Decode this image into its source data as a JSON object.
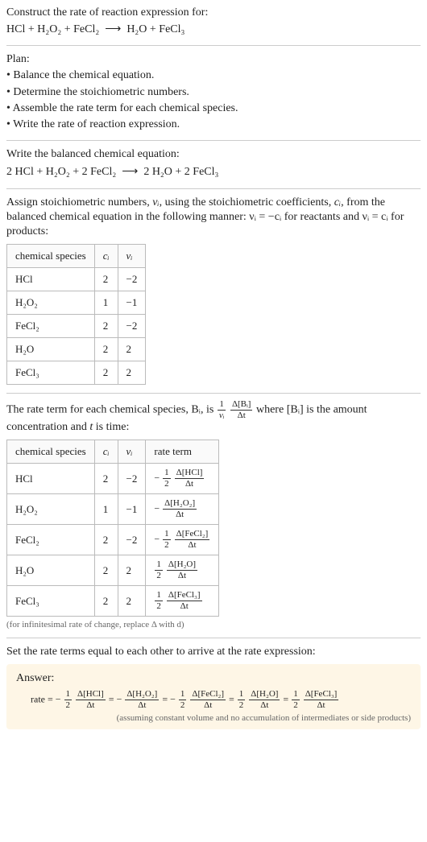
{
  "header": {
    "title": "Construct the rate of reaction expression for:",
    "equation_lhs": "HCl + H₂O₂ + FeCl₂",
    "arrow": "⟶",
    "equation_rhs": "H₂O + FeCl₃"
  },
  "plan": {
    "label": "Plan:",
    "items": [
      "• Balance the chemical equation.",
      "• Determine the stoichiometric numbers.",
      "• Assemble the rate term for each chemical species.",
      "• Write the rate of reaction expression."
    ]
  },
  "balanced": {
    "label": "Write the balanced chemical equation:",
    "equation_lhs": "2 HCl + H₂O₂ + 2 FeCl₂",
    "arrow": "⟶",
    "equation_rhs": "2 H₂O + 2 FeCl₃"
  },
  "stoich_intro": {
    "pre": "Assign stoichiometric numbers, ",
    "nu_i": "νᵢ",
    "mid1": ", using the stoichiometric coefficients, ",
    "c_i": "cᵢ",
    "mid2": ", from the balanced chemical equation in the following manner: ",
    "rule1": "νᵢ = −cᵢ",
    "mid3": " for reactants and ",
    "rule2": "νᵢ = cᵢ",
    "mid4": " for products:"
  },
  "table1": {
    "headers": {
      "species": "chemical species",
      "c": "cᵢ",
      "nu": "νᵢ"
    },
    "rows": [
      {
        "species": "HCl",
        "c": "2",
        "nu": "−2"
      },
      {
        "species": "H₂O₂",
        "c": "1",
        "nu": "−1"
      },
      {
        "species": "FeCl₂",
        "c": "2",
        "nu": "−2"
      },
      {
        "species": "H₂O",
        "c": "2",
        "nu": "2"
      },
      {
        "species": "FeCl₃",
        "c": "2",
        "nu": "2"
      }
    ]
  },
  "rateterm_intro": {
    "pre": "The rate term for each chemical species, ",
    "B_i": "Bᵢ",
    "mid1": ", is ",
    "frac1_num": "1",
    "frac1_den": "νᵢ",
    "frac2_num": "Δ[Bᵢ]",
    "frac2_den": "Δt",
    "mid2": " where ",
    "conc": "[Bᵢ]",
    "mid3": " is the amount concentration and ",
    "t": "t",
    "mid4": " is time:"
  },
  "table2": {
    "headers": {
      "species": "chemical species",
      "c": "cᵢ",
      "nu": "νᵢ",
      "rate": "rate term"
    },
    "rows": [
      {
        "species": "HCl",
        "c": "2",
        "nu": "−2",
        "sign": "−",
        "coef_num": "1",
        "coef_den": "2",
        "d_num": "Δ[HCl]",
        "d_den": "Δt"
      },
      {
        "species": "H₂O₂",
        "c": "1",
        "nu": "−1",
        "sign": "−",
        "coef_num": "",
        "coef_den": "",
        "d_num": "Δ[H₂O₂]",
        "d_den": "Δt"
      },
      {
        "species": "FeCl₂",
        "c": "2",
        "nu": "−2",
        "sign": "−",
        "coef_num": "1",
        "coef_den": "2",
        "d_num": "Δ[FeCl₂]",
        "d_den": "Δt"
      },
      {
        "species": "H₂O",
        "c": "2",
        "nu": "2",
        "sign": "",
        "coef_num": "1",
        "coef_den": "2",
        "d_num": "Δ[H₂O]",
        "d_den": "Δt"
      },
      {
        "species": "FeCl₃",
        "c": "2",
        "nu": "2",
        "sign": "",
        "coef_num": "1",
        "coef_den": "2",
        "d_num": "Δ[FeCl₃]",
        "d_den": "Δt"
      }
    ]
  },
  "footnote": "(for infinitesimal rate of change, replace Δ with d)",
  "final_intro": "Set the rate terms equal to each other to arrive at the rate expression:",
  "answer": {
    "label": "Answer:",
    "rate_label": "rate = ",
    "terms": [
      {
        "sign": "−",
        "coef_num": "1",
        "coef_den": "2",
        "d_num": "Δ[HCl]",
        "d_den": "Δt"
      },
      {
        "sign": "−",
        "coef_num": "",
        "coef_den": "",
        "d_num": "Δ[H₂O₂]",
        "d_den": "Δt"
      },
      {
        "sign": "−",
        "coef_num": "1",
        "coef_den": "2",
        "d_num": "Δ[FeCl₂]",
        "d_den": "Δt"
      },
      {
        "sign": "",
        "coef_num": "1",
        "coef_den": "2",
        "d_num": "Δ[H₂O]",
        "d_den": "Δt"
      },
      {
        "sign": "",
        "coef_num": "1",
        "coef_den": "2",
        "d_num": "Δ[FeCl₃]",
        "d_den": "Δt"
      }
    ],
    "eq": " = ",
    "note": "(assuming constant volume and no accumulation of intermediates or side products)"
  }
}
